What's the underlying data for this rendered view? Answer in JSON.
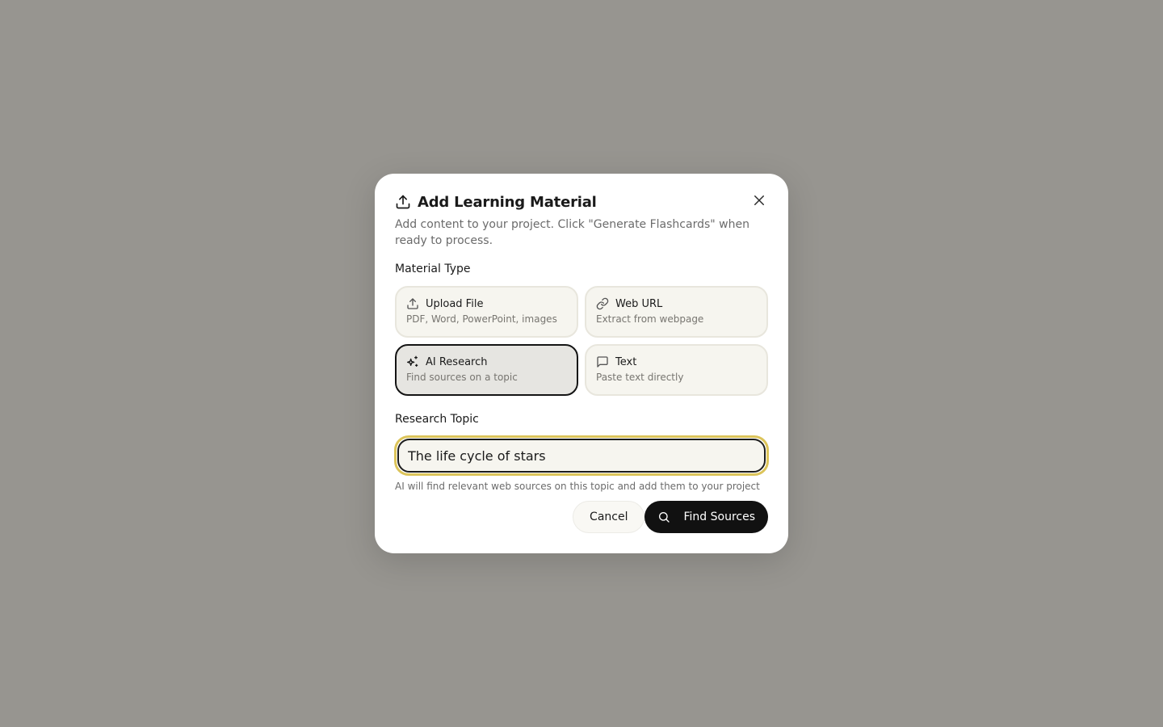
{
  "dialog": {
    "title": "Add Learning Material",
    "description": "Add content to your project. Click \"Generate Flashcards\" when ready to process.",
    "header_icon": "upload-icon",
    "close_icon": "close-icon"
  },
  "material_type": {
    "label": "Material Type",
    "selected": "ai_research",
    "options": [
      {
        "id": "upload_file",
        "title": "Upload File",
        "subtitle": "PDF, Word, PowerPoint, images",
        "icon": "upload-icon"
      },
      {
        "id": "web_url",
        "title": "Web URL",
        "subtitle": "Extract from webpage",
        "icon": "link-icon"
      },
      {
        "id": "ai_research",
        "title": "AI Research",
        "subtitle": "Find sources on a topic",
        "icon": "sparkles-icon"
      },
      {
        "id": "text",
        "title": "Text",
        "subtitle": "Paste text directly",
        "icon": "message-square-icon"
      }
    ]
  },
  "research_topic": {
    "label": "Research Topic",
    "value": "The life cycle of stars",
    "hint": "AI will find relevant web sources on this topic and add them to your project"
  },
  "actions": {
    "cancel_label": "Cancel",
    "primary_label": "Find Sources",
    "primary_icon": "search-icon"
  },
  "colors": {
    "backdrop": "#979590",
    "dialog_bg": "#ffffff",
    "card_bg": "#f6f5ef",
    "card_selected_bg": "#e6e5e1",
    "focus_ring": "#dcc45a",
    "primary_button": "#111111"
  }
}
